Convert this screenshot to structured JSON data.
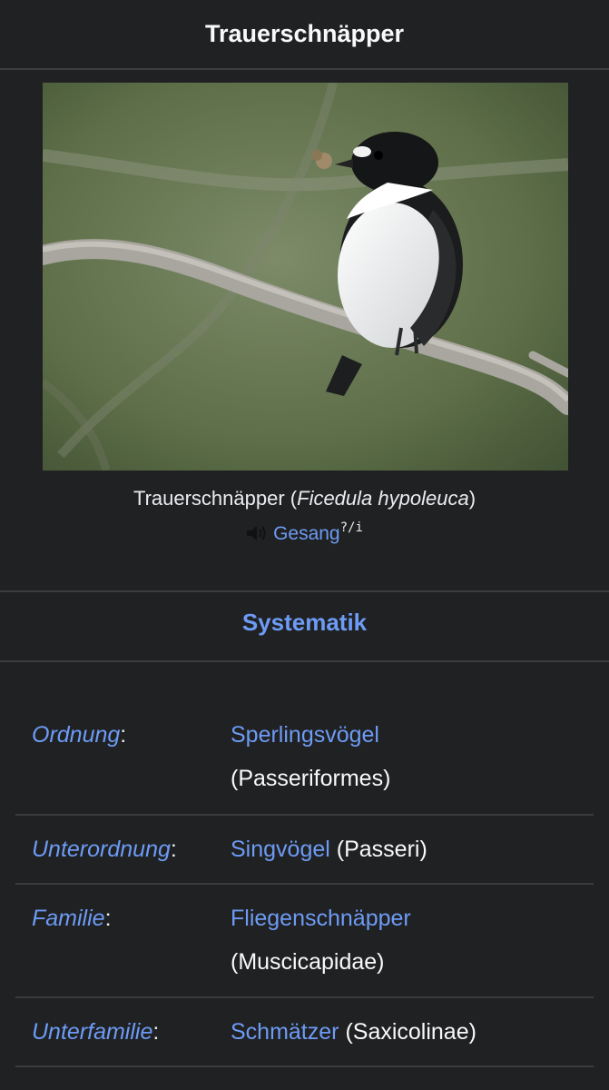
{
  "header": {
    "title": "Trauerschnäpper"
  },
  "photo": {
    "alt": "Trauerschnäpper (Ficedula hypoleuca)"
  },
  "caption": {
    "common_name": "Trauerschnäpper",
    "open_paren": " (",
    "scientific_name": "Ficedula hypoleuca",
    "close_paren": ")"
  },
  "audio": {
    "icon": "speaker-icon",
    "label": "Gesang",
    "help": "?/i"
  },
  "section": {
    "title": "Systematik"
  },
  "taxonomy": [
    {
      "rank": "Ordnung",
      "colon": ":",
      "taxon": "Sperlingsvögel",
      "latin": "(Passeriformes)"
    },
    {
      "rank": "Unterordnung",
      "colon": ":",
      "taxon": "Singvögel",
      "latin": "(Passeri)"
    },
    {
      "rank": "Familie",
      "colon": ":",
      "taxon": "Fliegenschnäpper",
      "latin": "(Muscicapidae)"
    },
    {
      "rank": "Unterfamilie",
      "colon": ":",
      "taxon": "Schmätzer",
      "latin": "(Saxicolinae)"
    }
  ],
  "colors": {
    "background": "#202122",
    "link": "#6d9bf5",
    "divider": "#3a3c3f",
    "text": "#eaecf0"
  }
}
